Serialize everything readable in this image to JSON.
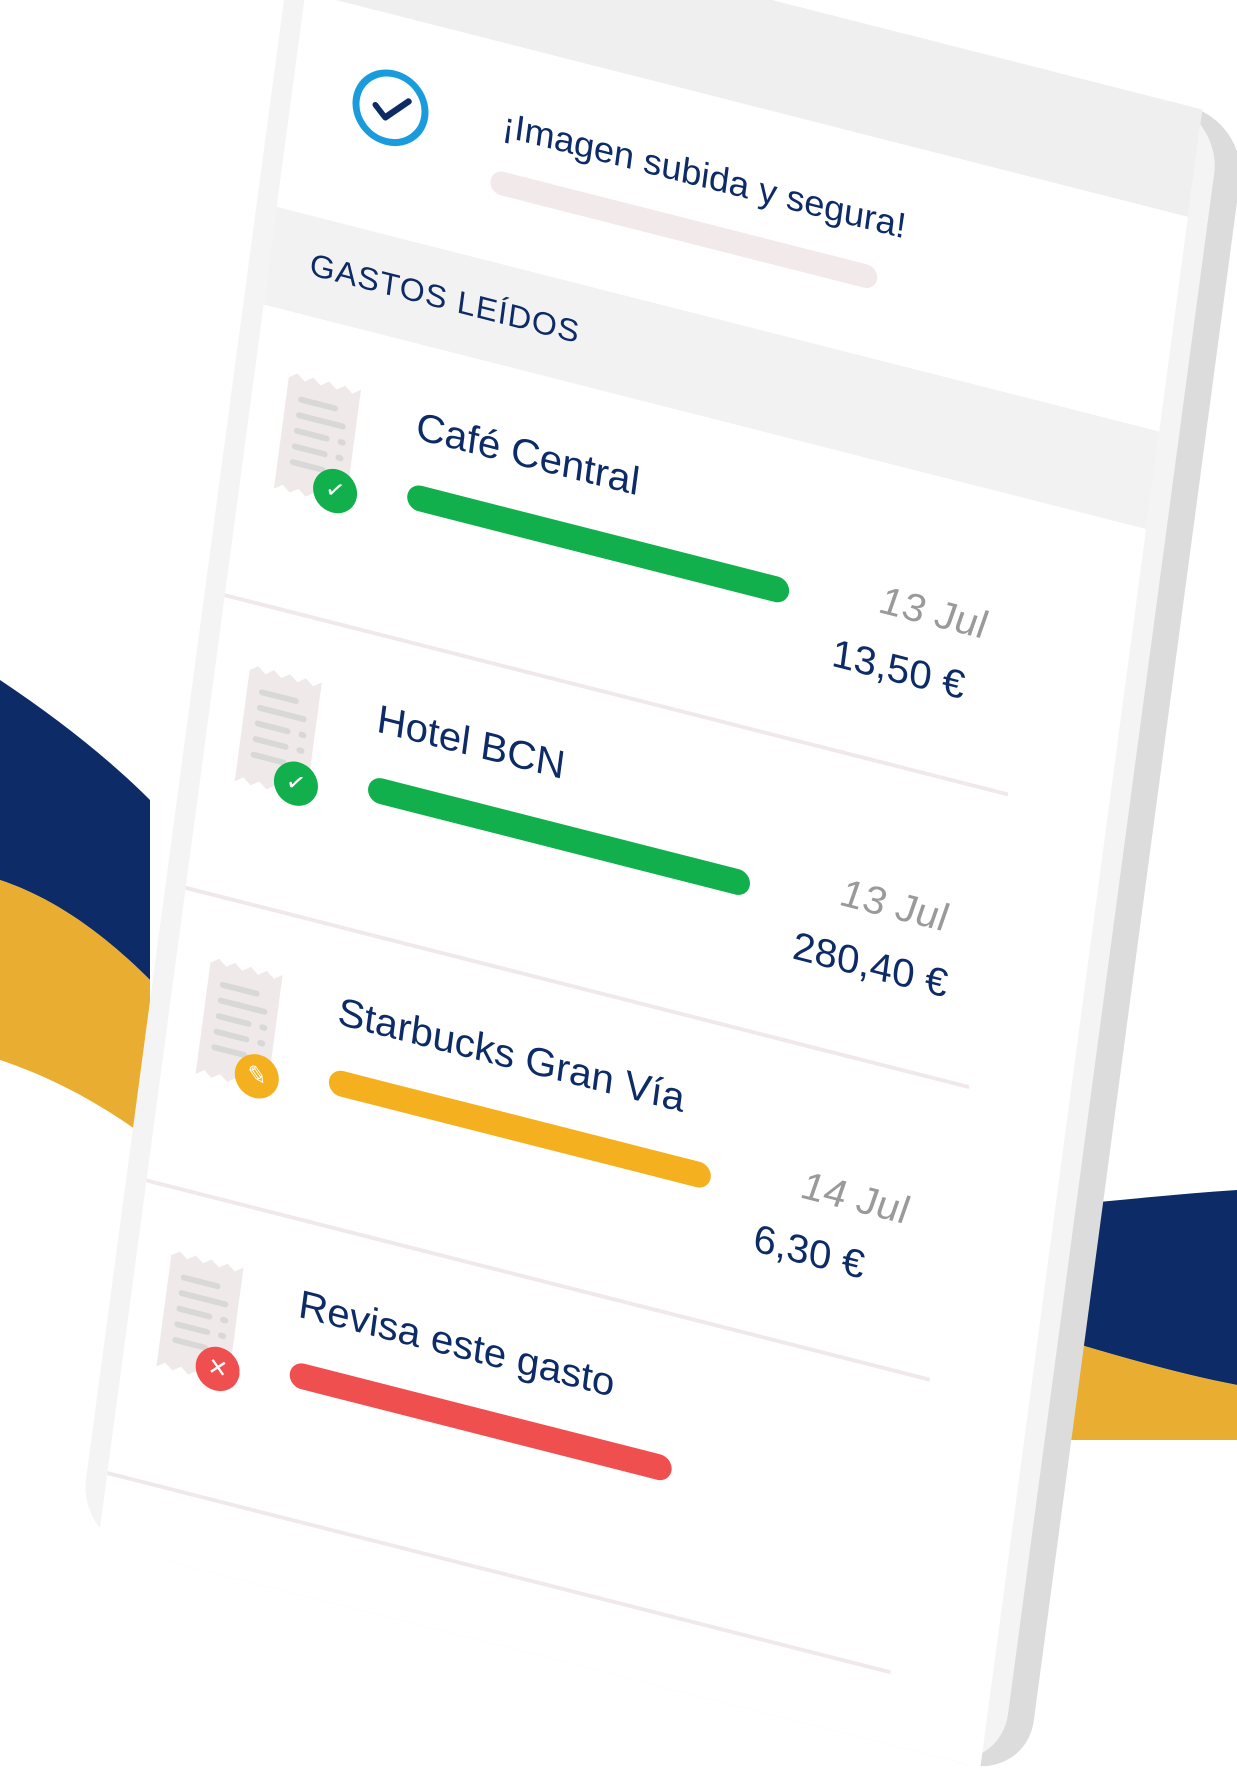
{
  "colors": {
    "navy": "#0d2b66",
    "gold": "#e9ae31",
    "accent_blue": "#1a9cdc",
    "status_ok": "#12b04c",
    "status_edit": "#f5b020",
    "status_error": "#f04f4f"
  },
  "upload": {
    "message": "¡Imagen subida y segura!",
    "icon": "check-circle-icon"
  },
  "section": {
    "title": "GASTOS LEÍDOS"
  },
  "expenses": [
    {
      "merchant": "Café Central",
      "date": "13 Jul",
      "amount": "13,50 €",
      "status": "ok",
      "status_icon": "check-icon",
      "progress": 1.0
    },
    {
      "merchant": "Hotel BCN",
      "date": "13 Jul",
      "amount": "280,40 €",
      "status": "ok",
      "status_icon": "check-icon",
      "progress": 1.0
    },
    {
      "merchant": "Starbucks Gran Vía",
      "date": "14 Jul",
      "amount": "6,30 €",
      "status": "edit",
      "status_icon": "pencil-icon",
      "progress": 1.0
    },
    {
      "merchant": "Revisa este gasto",
      "date": "",
      "amount": "",
      "status": "error",
      "status_icon": "close-icon",
      "progress": 1.0
    }
  ]
}
